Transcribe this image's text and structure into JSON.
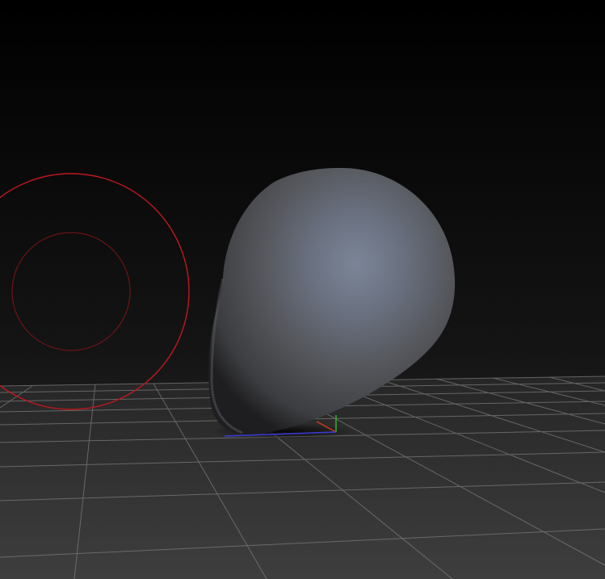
{
  "viewport": {
    "background_top": "#000000",
    "background_bottom": "#2a2a2a",
    "floor_color": "#3a3a3a",
    "grid_line_color": "#7a7a7a"
  },
  "brush_cursor": {
    "icon": "brush-radius-icon",
    "outer_ring_color": "#c0181e",
    "inner_ring_color": "#6e1416"
  },
  "model": {
    "icon": "sculpt-mesh",
    "base_color": "#4a4b4e",
    "highlight_color": "#7d8799"
  },
  "gizmo": {
    "x_axis_color": "#d03a1a",
    "y_axis_color": "#2fb62f",
    "z_axis_color": "#3b3bd8"
  }
}
